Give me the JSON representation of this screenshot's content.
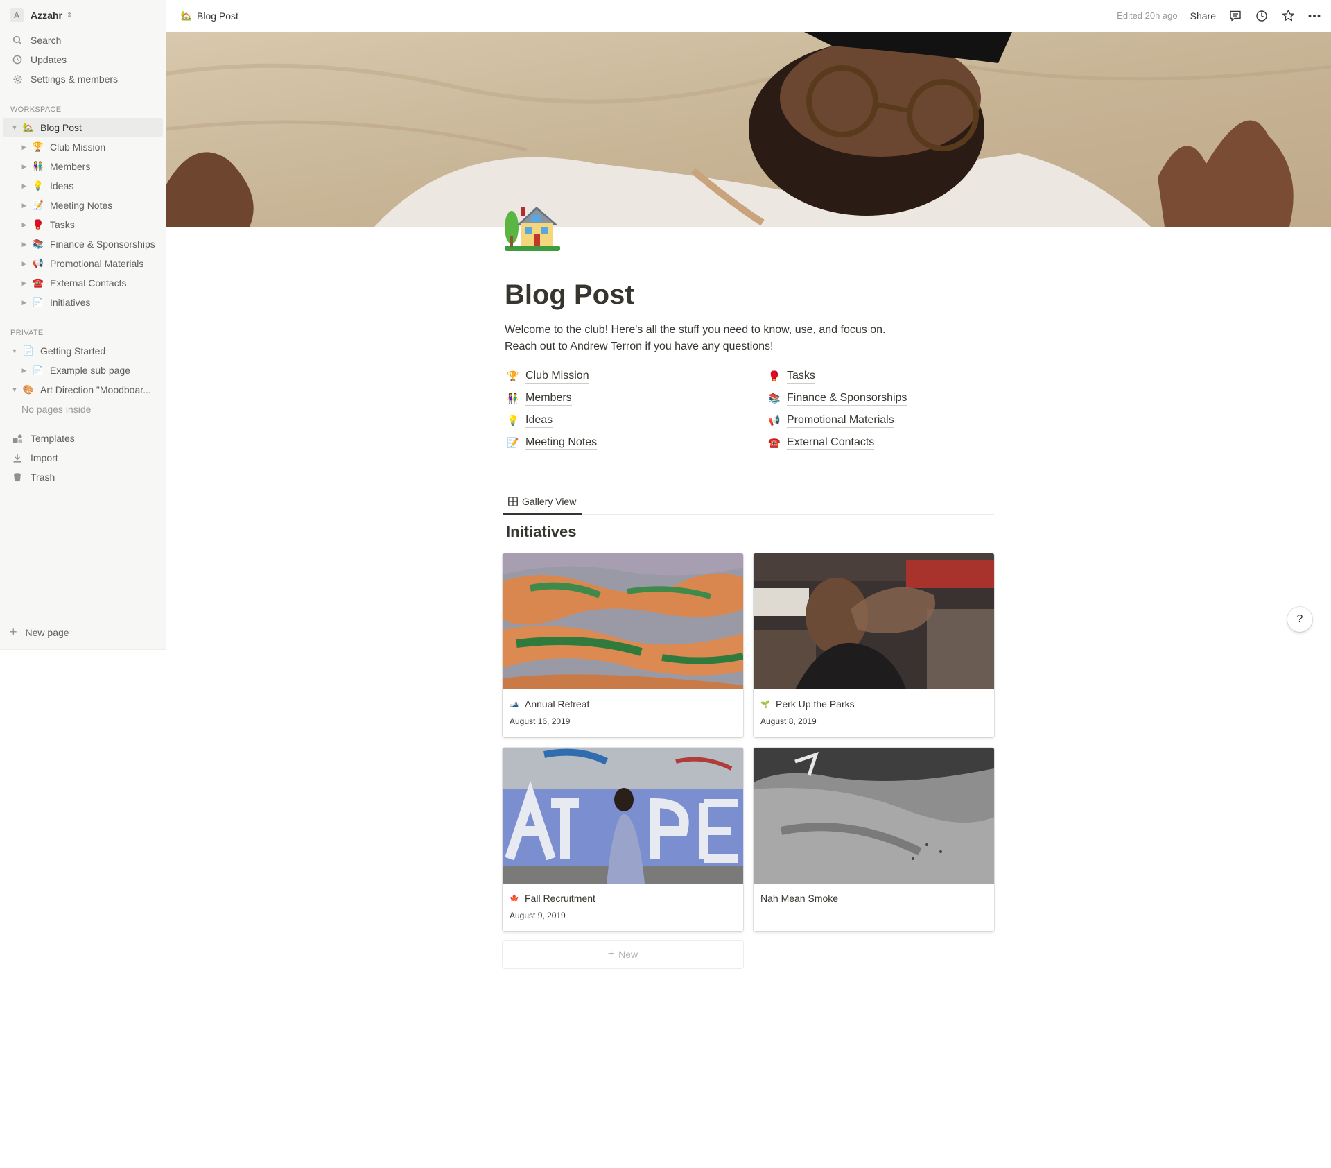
{
  "workspace": {
    "avatar_letter": "A",
    "name": "Azzahr"
  },
  "sidebar": {
    "top_items": [
      {
        "label": "Search",
        "icon": "search-icon"
      },
      {
        "label": "Updates",
        "icon": "clock-icon"
      },
      {
        "label": "Settings & members",
        "icon": "gear-icon"
      }
    ],
    "workspace_section": "WORKSPACE",
    "workspace_root": {
      "label": "Blog Post",
      "emoji": "🏡"
    },
    "workspace_children": [
      {
        "label": "Club Mission",
        "emoji": "🏆"
      },
      {
        "label": "Members",
        "emoji": "👫"
      },
      {
        "label": "Ideas",
        "emoji": "💡"
      },
      {
        "label": "Meeting Notes",
        "emoji": "📝"
      },
      {
        "label": "Tasks",
        "emoji": "🥊"
      },
      {
        "label": "Finance & Sponsorships",
        "emoji": "📚"
      },
      {
        "label": "Promotional Materials",
        "emoji": "📢"
      },
      {
        "label": "External Contacts",
        "emoji": "☎️"
      },
      {
        "label": "Initiatives",
        "emoji": "📄"
      }
    ],
    "private_section": "PRIVATE",
    "private_items": [
      {
        "label": "Getting Started",
        "emoji": "📄"
      },
      {
        "label": "Example sub page",
        "emoji": "📄"
      },
      {
        "label": "Art Direction \"Moodboar...",
        "emoji": "🎨"
      }
    ],
    "no_pages_inside": "No pages inside",
    "bottom_items": [
      {
        "label": "Templates",
        "icon": "templates-icon"
      },
      {
        "label": "Import",
        "icon": "import-icon"
      },
      {
        "label": "Trash",
        "icon": "trash-icon"
      }
    ],
    "new_page": "New page"
  },
  "topbar": {
    "breadcrumb_emoji": "🏡",
    "breadcrumb": "Blog Post",
    "edited": "Edited 20h ago",
    "share": "Share"
  },
  "page": {
    "emoji": "🏡",
    "title": "Blog Post",
    "description_line1": "Welcome to the club! Here's all the stuff you need to know, use, and focus on.",
    "description_line2": "Reach out to Andrew Terron if you have any questions!",
    "links_left": [
      {
        "label": "Club Mission",
        "emoji": "🏆"
      },
      {
        "label": "Members",
        "emoji": "👫"
      },
      {
        "label": "Ideas",
        "emoji": "💡"
      },
      {
        "label": "Meeting Notes",
        "emoji": "📝"
      }
    ],
    "links_right": [
      {
        "label": "Tasks",
        "emoji": "🥊"
      },
      {
        "label": "Finance & Sponsorships",
        "emoji": "📚"
      },
      {
        "label": "Promotional Materials",
        "emoji": "📢"
      },
      {
        "label": "External Contacts",
        "emoji": "☎️"
      }
    ]
  },
  "database": {
    "view_tab": "Gallery View",
    "title": "Initiatives",
    "cards": [
      {
        "name": "Annual Retreat",
        "emoji": "🎿",
        "date": "August 16, 2019"
      },
      {
        "name": "Perk Up the Parks",
        "emoji": "🌱",
        "date": "August 8, 2019"
      },
      {
        "name": "Fall Recruitment",
        "emoji": "🍁",
        "date": "August 9, 2019"
      },
      {
        "name": "Nah Mean Smoke",
        "emoji": "",
        "date": ""
      }
    ],
    "new_label": "New"
  },
  "help": "?"
}
